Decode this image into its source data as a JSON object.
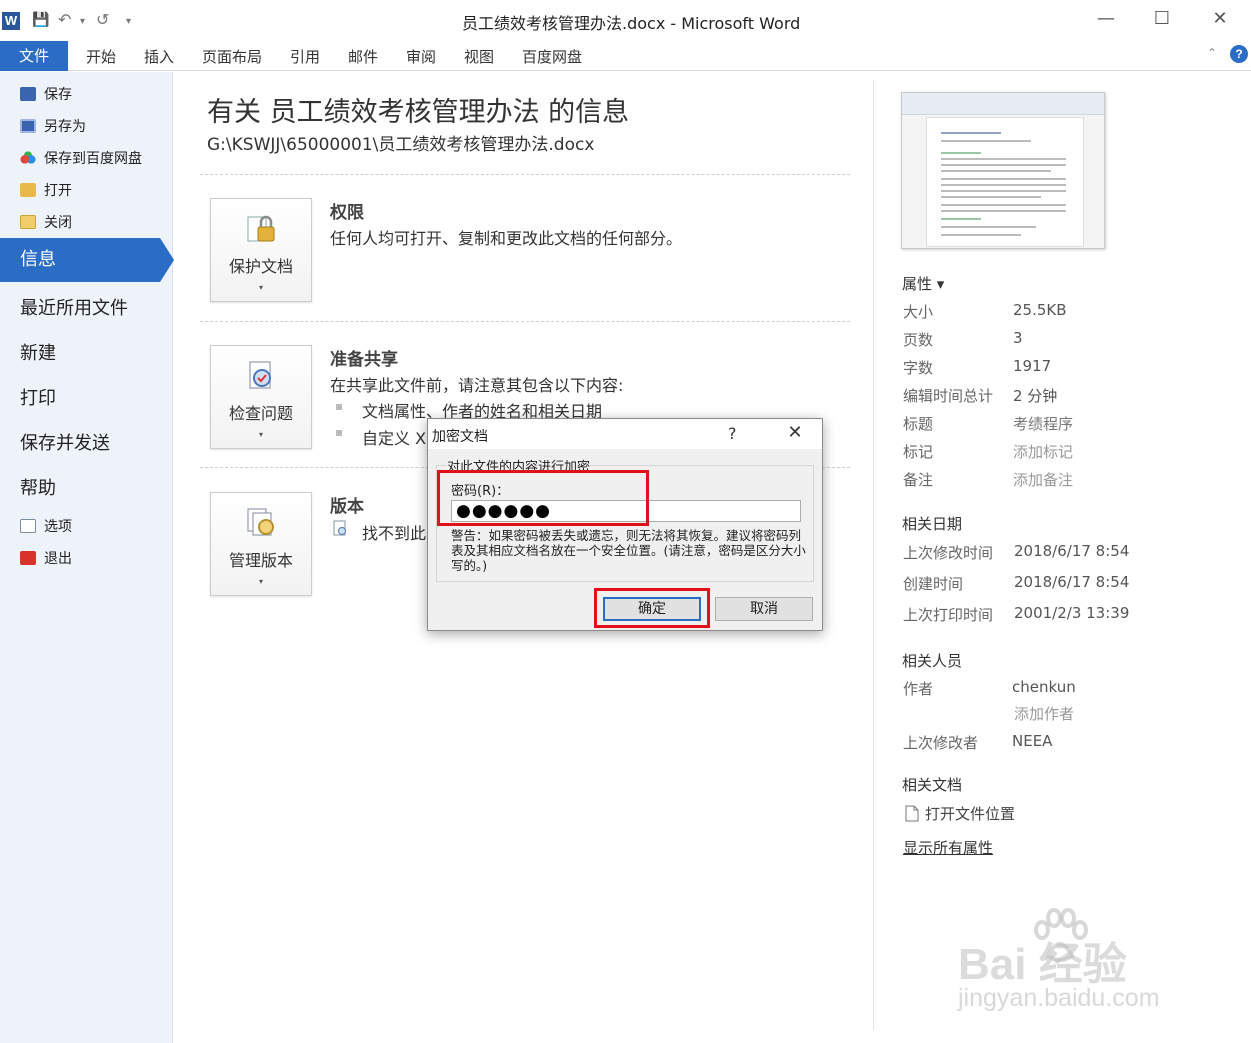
{
  "window": {
    "title": "员工绩效考核管理办法.docx - Microsoft Word",
    "app_icon_letter": "W",
    "controls": {
      "minimize": "—",
      "maximize": "☐",
      "close": "✕"
    }
  },
  "quick_access": {
    "save": "💾",
    "undo": "↶",
    "undo_drop": "▾",
    "redo": "↺",
    "customize": "▾"
  },
  "ribbon": {
    "file_tab": "文件",
    "tabs": [
      "开始",
      "插入",
      "页面布局",
      "引用",
      "邮件",
      "审阅",
      "视图",
      "百度网盘"
    ],
    "collapse": "⌃",
    "help": "?"
  },
  "nav": {
    "small_items": [
      {
        "label": "保存",
        "icon": "save-icon"
      },
      {
        "label": "另存为",
        "icon": "save-as-icon"
      },
      {
        "label": "保存到百度网盘",
        "icon": "baidu-cloud-icon"
      },
      {
        "label": "打开",
        "icon": "open-folder-icon"
      },
      {
        "label": "关闭",
        "icon": "close-folder-icon"
      }
    ],
    "selected": "信息",
    "large_items": [
      "最近所用文件",
      "新建",
      "打印",
      "保存并发送",
      "帮助"
    ],
    "bottom_items": [
      {
        "label": "选项",
        "icon": "options-icon"
      },
      {
        "label": "退出",
        "icon": "exit-icon"
      }
    ]
  },
  "info": {
    "title": "有关 员工绩效考核管理办法 的信息",
    "path": "G:\\KSWJJ\\65000001\\员工绩效考核管理办法.docx",
    "sections": [
      {
        "button": "保护文档",
        "heading": "权限",
        "text": "任何人均可打开、复制和更改此文档的任何部分。"
      },
      {
        "button": "检查问题",
        "heading": "准备共享",
        "text": "在共享此文件前，请注意其包含以下内容:",
        "bullets": [
          "文档属性、作者的姓名和相关日期",
          "自定义 X"
        ]
      },
      {
        "button": "管理版本",
        "heading": "版本",
        "text": "找不到此"
      }
    ],
    "dropdown_arrow": "▾"
  },
  "properties": {
    "header": "属性 ▾",
    "rows": [
      {
        "label": "大小",
        "value": "25.5KB"
      },
      {
        "label": "页数",
        "value": "3"
      },
      {
        "label": "字数",
        "value": "1917"
      },
      {
        "label": "编辑时间总计",
        "value": "2 分钟"
      },
      {
        "label": "标题",
        "value": "考绩程序"
      },
      {
        "label": "标记",
        "value": "添加标记"
      },
      {
        "label": "备注",
        "value": "添加备注"
      }
    ],
    "dates_header": "相关日期",
    "dates": [
      {
        "label": "上次修改时间",
        "value": "2018/6/17 8:54"
      },
      {
        "label": "创建时间",
        "value": "2018/6/17 8:54"
      },
      {
        "label": "上次打印时间",
        "value": "2001/2/3 13:39"
      }
    ],
    "people_header": "相关人员",
    "author_label": "作者",
    "author": "chenkun",
    "add_author": "添加作者",
    "last_modified_by_label": "上次修改者",
    "last_modified_by": "NEEA",
    "docs_header": "相关文档",
    "open_location": "打开文件位置",
    "show_all": "显示所有属性"
  },
  "dialog": {
    "title": "加密文档",
    "help": "?",
    "close": "✕",
    "prompt": "对此文件的内容进行加密",
    "password_label": "密码(R)：",
    "password_value": "●●●●●●",
    "warning": "警告：如果密码被丢失或遗忘，则无法将其恢复。建议将密码列表及其相应文档名放在一个安全位置。(请注意，密码是区分大小写的。)",
    "ok": "确定",
    "cancel": "取消"
  },
  "watermark": {
    "brand": "Bai  经验",
    "url": "jingyan.baidu.com"
  },
  "colors": {
    "accent": "#2b6cc4",
    "highlight": "#e0111b",
    "nav_bg": "#eef3fa"
  }
}
